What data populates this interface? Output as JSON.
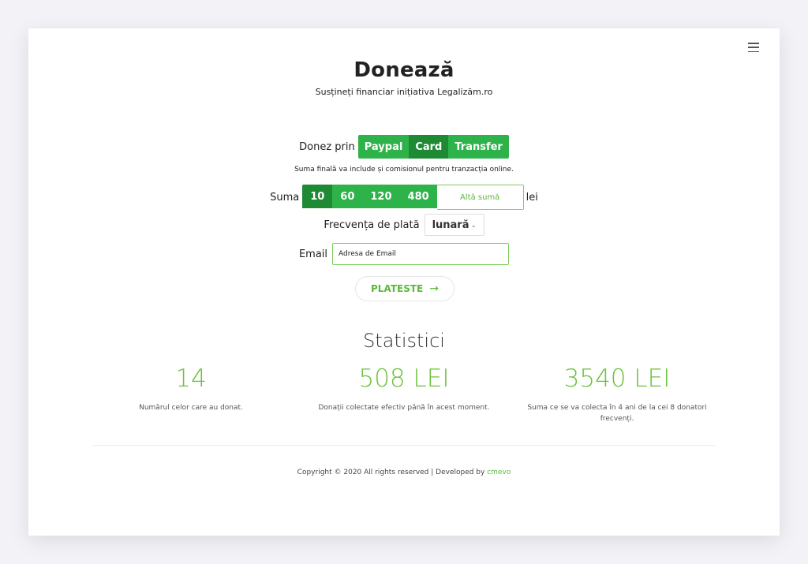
{
  "header": {
    "title": "Donează",
    "subtitle": "Susțineți financiar inițiativa Legalizăm.ro"
  },
  "form": {
    "method_label": "Donez prin",
    "methods": [
      "Paypal",
      "Card",
      "Transfer"
    ],
    "selected_method": "Card",
    "note": "Suma finală va include și comisionul pentru tranzacția online.",
    "amount_label": "Suma",
    "amounts": [
      "10",
      "60",
      "120",
      "480"
    ],
    "selected_amount": "10",
    "other_amount_placeholder": "Altă sumă",
    "currency": "lei",
    "frequency_label": "Frecvența de plată",
    "frequency_value": "lunară",
    "email_label": "Email",
    "email_placeholder": "Adresa de Email",
    "submit_label": "PLATESTE"
  },
  "stats": {
    "title": "Statistici",
    "items": [
      {
        "value": "14",
        "desc": "Numărul celor care au donat."
      },
      {
        "value": "508 LEI",
        "desc": "Donații colectate efectiv până în acest moment."
      },
      {
        "value": "3540 LEI",
        "desc": "Suma ce se va colecta în 4 ani de la cei 8 donatori frecvenți."
      }
    ]
  },
  "footer": {
    "text": "Copyright © 2020 All rights reserved | Developed by",
    "link": "cmevo"
  },
  "colors": {
    "accent_green": "#2db34a",
    "accent_green_active": "#1e8a34",
    "light_green": "#6cc23a"
  },
  "icons": {
    "menu": "hamburger-menu-icon",
    "submit_arrow": "arrow-right-icon",
    "select": "chevron-down-icon"
  }
}
